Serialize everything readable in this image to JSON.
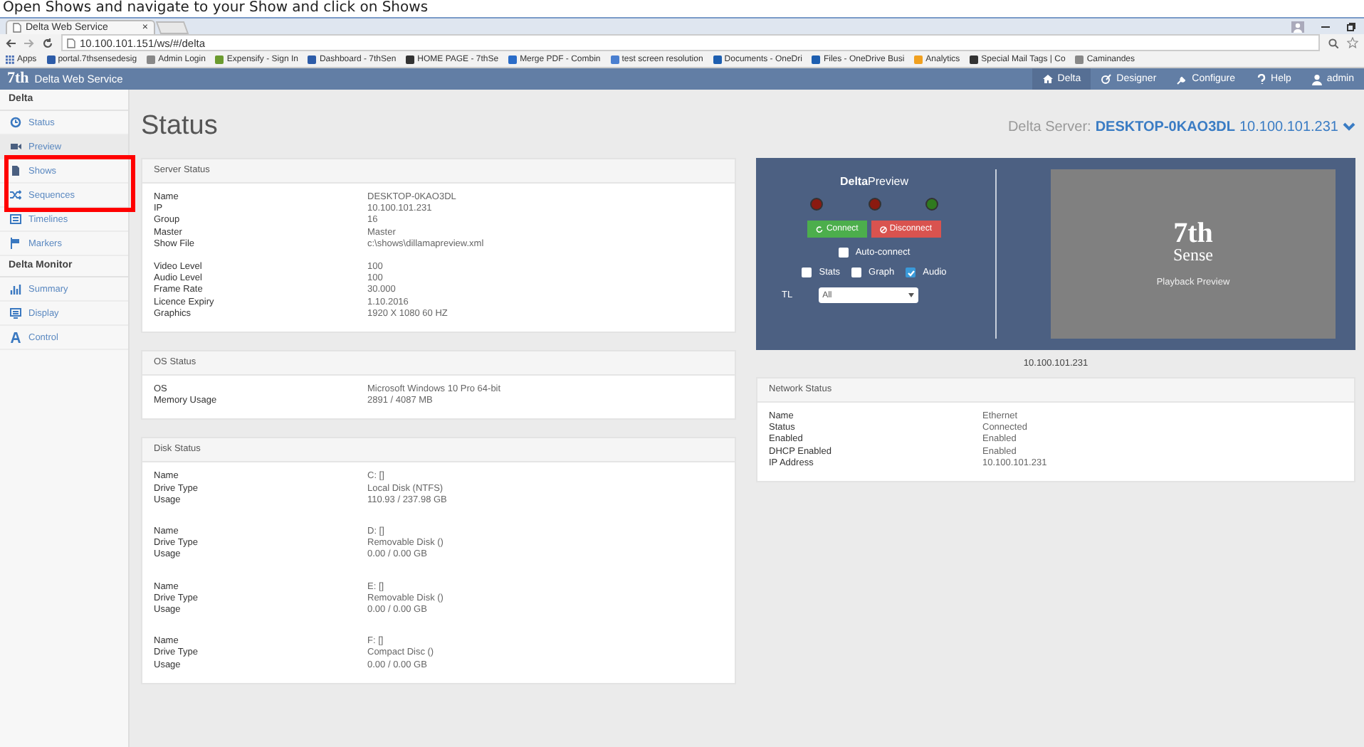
{
  "caption": "Open Shows and navigate to your Show and click on Shows",
  "browser": {
    "tab_title": "Delta Web Service",
    "tab_close": "×",
    "url": "10.100.101.151/ws/#/delta",
    "bookmarks": [
      "Apps",
      "portal.7thsensedesig",
      "Admin Login",
      "Expensify - Sign In",
      "Dashboard - 7thSen",
      "HOME PAGE - 7thSe",
      "Merge PDF - Combin",
      "test screen resolution",
      "Documents - OneDri",
      "Files - OneDrive Busi",
      "Analytics",
      "Special Mail Tags | Co",
      "Caminandes"
    ]
  },
  "header": {
    "logo": "7th",
    "title": "Delta Web Service",
    "nav": [
      {
        "label": "Delta",
        "selected": true
      },
      {
        "label": "Designer",
        "selected": false
      },
      {
        "label": "Configure",
        "selected": false
      },
      {
        "label": "Help",
        "selected": false
      },
      {
        "label": "admin",
        "selected": false
      }
    ]
  },
  "sidebar": {
    "sections": [
      {
        "title": "Delta",
        "items": [
          {
            "label": "Status",
            "selected": false
          },
          {
            "label": "Preview",
            "selected": true
          },
          {
            "label": "Shows",
            "selected": false
          },
          {
            "label": "Sequences",
            "selected": false
          },
          {
            "label": "Timelines",
            "selected": false
          },
          {
            "label": "Markers",
            "selected": false
          }
        ]
      },
      {
        "title": "Delta Monitor",
        "items": [
          {
            "label": "Summary",
            "selected": false
          },
          {
            "label": "Display",
            "selected": false
          },
          {
            "label": "Control",
            "selected": false
          }
        ]
      }
    ]
  },
  "page": {
    "title": "Status",
    "server_label": "Delta Server:",
    "server_name": "DESKTOP-0KAO3DL",
    "server_ip": "10.100.101.231"
  },
  "server_status": {
    "title": "Server Status",
    "groups": [
      [
        [
          "Name",
          "DESKTOP-0KAO3DL"
        ],
        [
          "IP",
          "10.100.101.231"
        ],
        [
          "Group",
          "16"
        ],
        [
          "Master",
          "Master"
        ],
        [
          "Show File",
          "c:\\shows\\dillamapreview.xml"
        ]
      ],
      [
        [
          "Video Level",
          "100"
        ],
        [
          "Audio Level",
          "100"
        ],
        [
          "Frame Rate",
          "30.000"
        ],
        [
          "Licence Expiry",
          "1.10.2016"
        ],
        [
          "Graphics",
          "1920 X 1080 60 HZ"
        ]
      ]
    ]
  },
  "preview": {
    "title": "**Delta**Preview",
    "leds": [
      {
        "color": "#8b1a10"
      },
      {
        "color": "#8b1a10"
      },
      {
        "color": "#2f7a1f"
      }
    ],
    "connect": "Connect",
    "disconnect": "Disconnect",
    "auto_connect": {
      "label": "Auto-connect",
      "checked": false
    },
    "options": [
      {
        "label": "Stats",
        "checked": false
      },
      {
        "label": "Graph",
        "checked": false
      },
      {
        "label": "Audio",
        "checked": true
      }
    ],
    "tl_label": "TL",
    "tl_value": "All",
    "logo_top": "7th",
    "logo_bottom": "Sense",
    "caption": "Playback Preview",
    "ip": "10.100.101.231"
  },
  "os_status": {
    "title": "OS Status",
    "groups": [
      [
        [
          "OS",
          "Microsoft Windows 10 Pro 64-bit"
        ],
        [
          "Memory Usage",
          "2891 / 4087 MB"
        ]
      ]
    ]
  },
  "network_status": {
    "title": "Network Status",
    "groups": [
      [
        [
          "Name",
          "Ethernet"
        ],
        [
          "Status",
          "Connected"
        ],
        [
          "Enabled",
          "Enabled"
        ],
        [
          "DHCP Enabled",
          "Enabled"
        ],
        [
          "IP Address",
          "10.100.101.231"
        ]
      ]
    ]
  },
  "disk_status": {
    "title": "Disk Status",
    "groups": [
      [
        [
          "Name",
          "C: []"
        ],
        [
          "Drive Type",
          "Local Disk (NTFS)"
        ],
        [
          "Usage",
          "110.93 / 237.98 GB"
        ]
      ],
      [
        [
          "Name",
          "D: []"
        ],
        [
          "Drive Type",
          "Removable Disk ()"
        ],
        [
          "Usage",
          "0.00 / 0.00 GB"
        ]
      ],
      [
        [
          "Name",
          "E: []"
        ],
        [
          "Drive Type",
          "Removable Disk ()"
        ],
        [
          "Usage",
          "0.00 / 0.00 GB"
        ]
      ],
      [
        [
          "Name",
          "F: []"
        ],
        [
          "Drive Type",
          "Compact Disc ()"
        ],
        [
          "Usage",
          "0.00 / 0.00 GB"
        ]
      ]
    ]
  }
}
